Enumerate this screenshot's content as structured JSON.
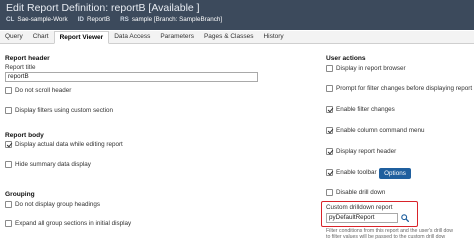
{
  "header": {
    "title": "Edit  Report Definition: reportB [Available ]",
    "cl_key": "CL",
    "cl_val": "Sae-sample-Work",
    "id_key": "ID",
    "id_val": "ReportB",
    "rs_key": "RS",
    "rs_val": "sample [Branch: SampleBranch]"
  },
  "tabs": [
    "Query",
    "Chart",
    "Report Viewer",
    "Data Access",
    "Parameters",
    "Pages & Classes",
    "History"
  ],
  "left": {
    "report_header": {
      "section": "Report header",
      "title_label": "Report title",
      "title_value": "reportB",
      "no_scroll": "Do not scroll header",
      "filters_custom": "Display filters using custom section"
    },
    "report_body": {
      "section": "Report body",
      "display_actual": "Display actual data while editing report",
      "hide_summary": "Hide summary data display"
    },
    "grouping": {
      "section": "Grouping",
      "no_group_headings": "Do not display group headings",
      "expand_all": "Expand all group sections in initial display"
    }
  },
  "right": {
    "section": "User actions",
    "display_in_browser": "Display in report browser",
    "prompt_filter": "Prompt for filter changes before displaying report",
    "enable_filter": "Enable filter changes",
    "enable_column_menu": "Enable column command menu",
    "display_report_header": "Display report header",
    "enable_toolbar": "Enable toolbar",
    "options_button": "Options",
    "disable_drill": "Disable drill down",
    "custom_drill_label": "Custom drilldown report",
    "custom_drill_value": "pyDefaultReport",
    "note_line1": "Filter conditions from this report and the user's drill dow",
    "note_line2": "to filter values will be passed to the custom drill dow"
  },
  "colors": {
    "header_bg": "#3c4a5c",
    "accent": "#1f5f9e",
    "highlight_border": "#d8232a"
  }
}
